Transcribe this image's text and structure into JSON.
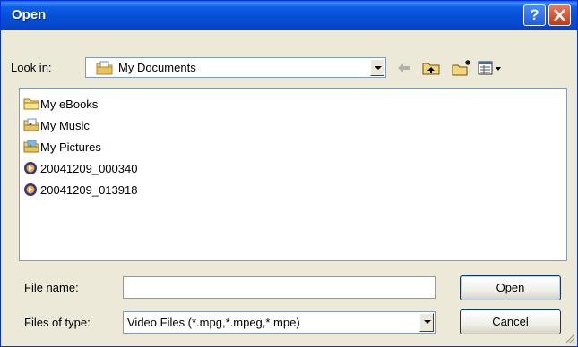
{
  "window": {
    "title": "Open"
  },
  "toolbar": {
    "look_in_label": "Look in:",
    "look_in_value": "My Documents",
    "back_icon": "back-arrow-icon",
    "up_icon": "up-folder-icon",
    "new_folder_icon": "new-folder-icon",
    "views_icon": "views-menu-icon"
  },
  "files": [
    {
      "name": "My eBooks",
      "icon": "folder-icon"
    },
    {
      "name": "My Music",
      "icon": "music-folder-icon"
    },
    {
      "name": "My Pictures",
      "icon": "pictures-folder-icon"
    },
    {
      "name": "20041209_000340",
      "icon": "media-file-icon"
    },
    {
      "name": "20041209_013918",
      "icon": "media-file-icon"
    }
  ],
  "form": {
    "file_name_label": "File name:",
    "file_name_value": "",
    "file_type_label": "Files of type:",
    "file_type_value": "Video Files (*.mpg,*.mpeg,*.mpe)"
  },
  "buttons": {
    "open": "Open",
    "cancel": "Cancel"
  }
}
